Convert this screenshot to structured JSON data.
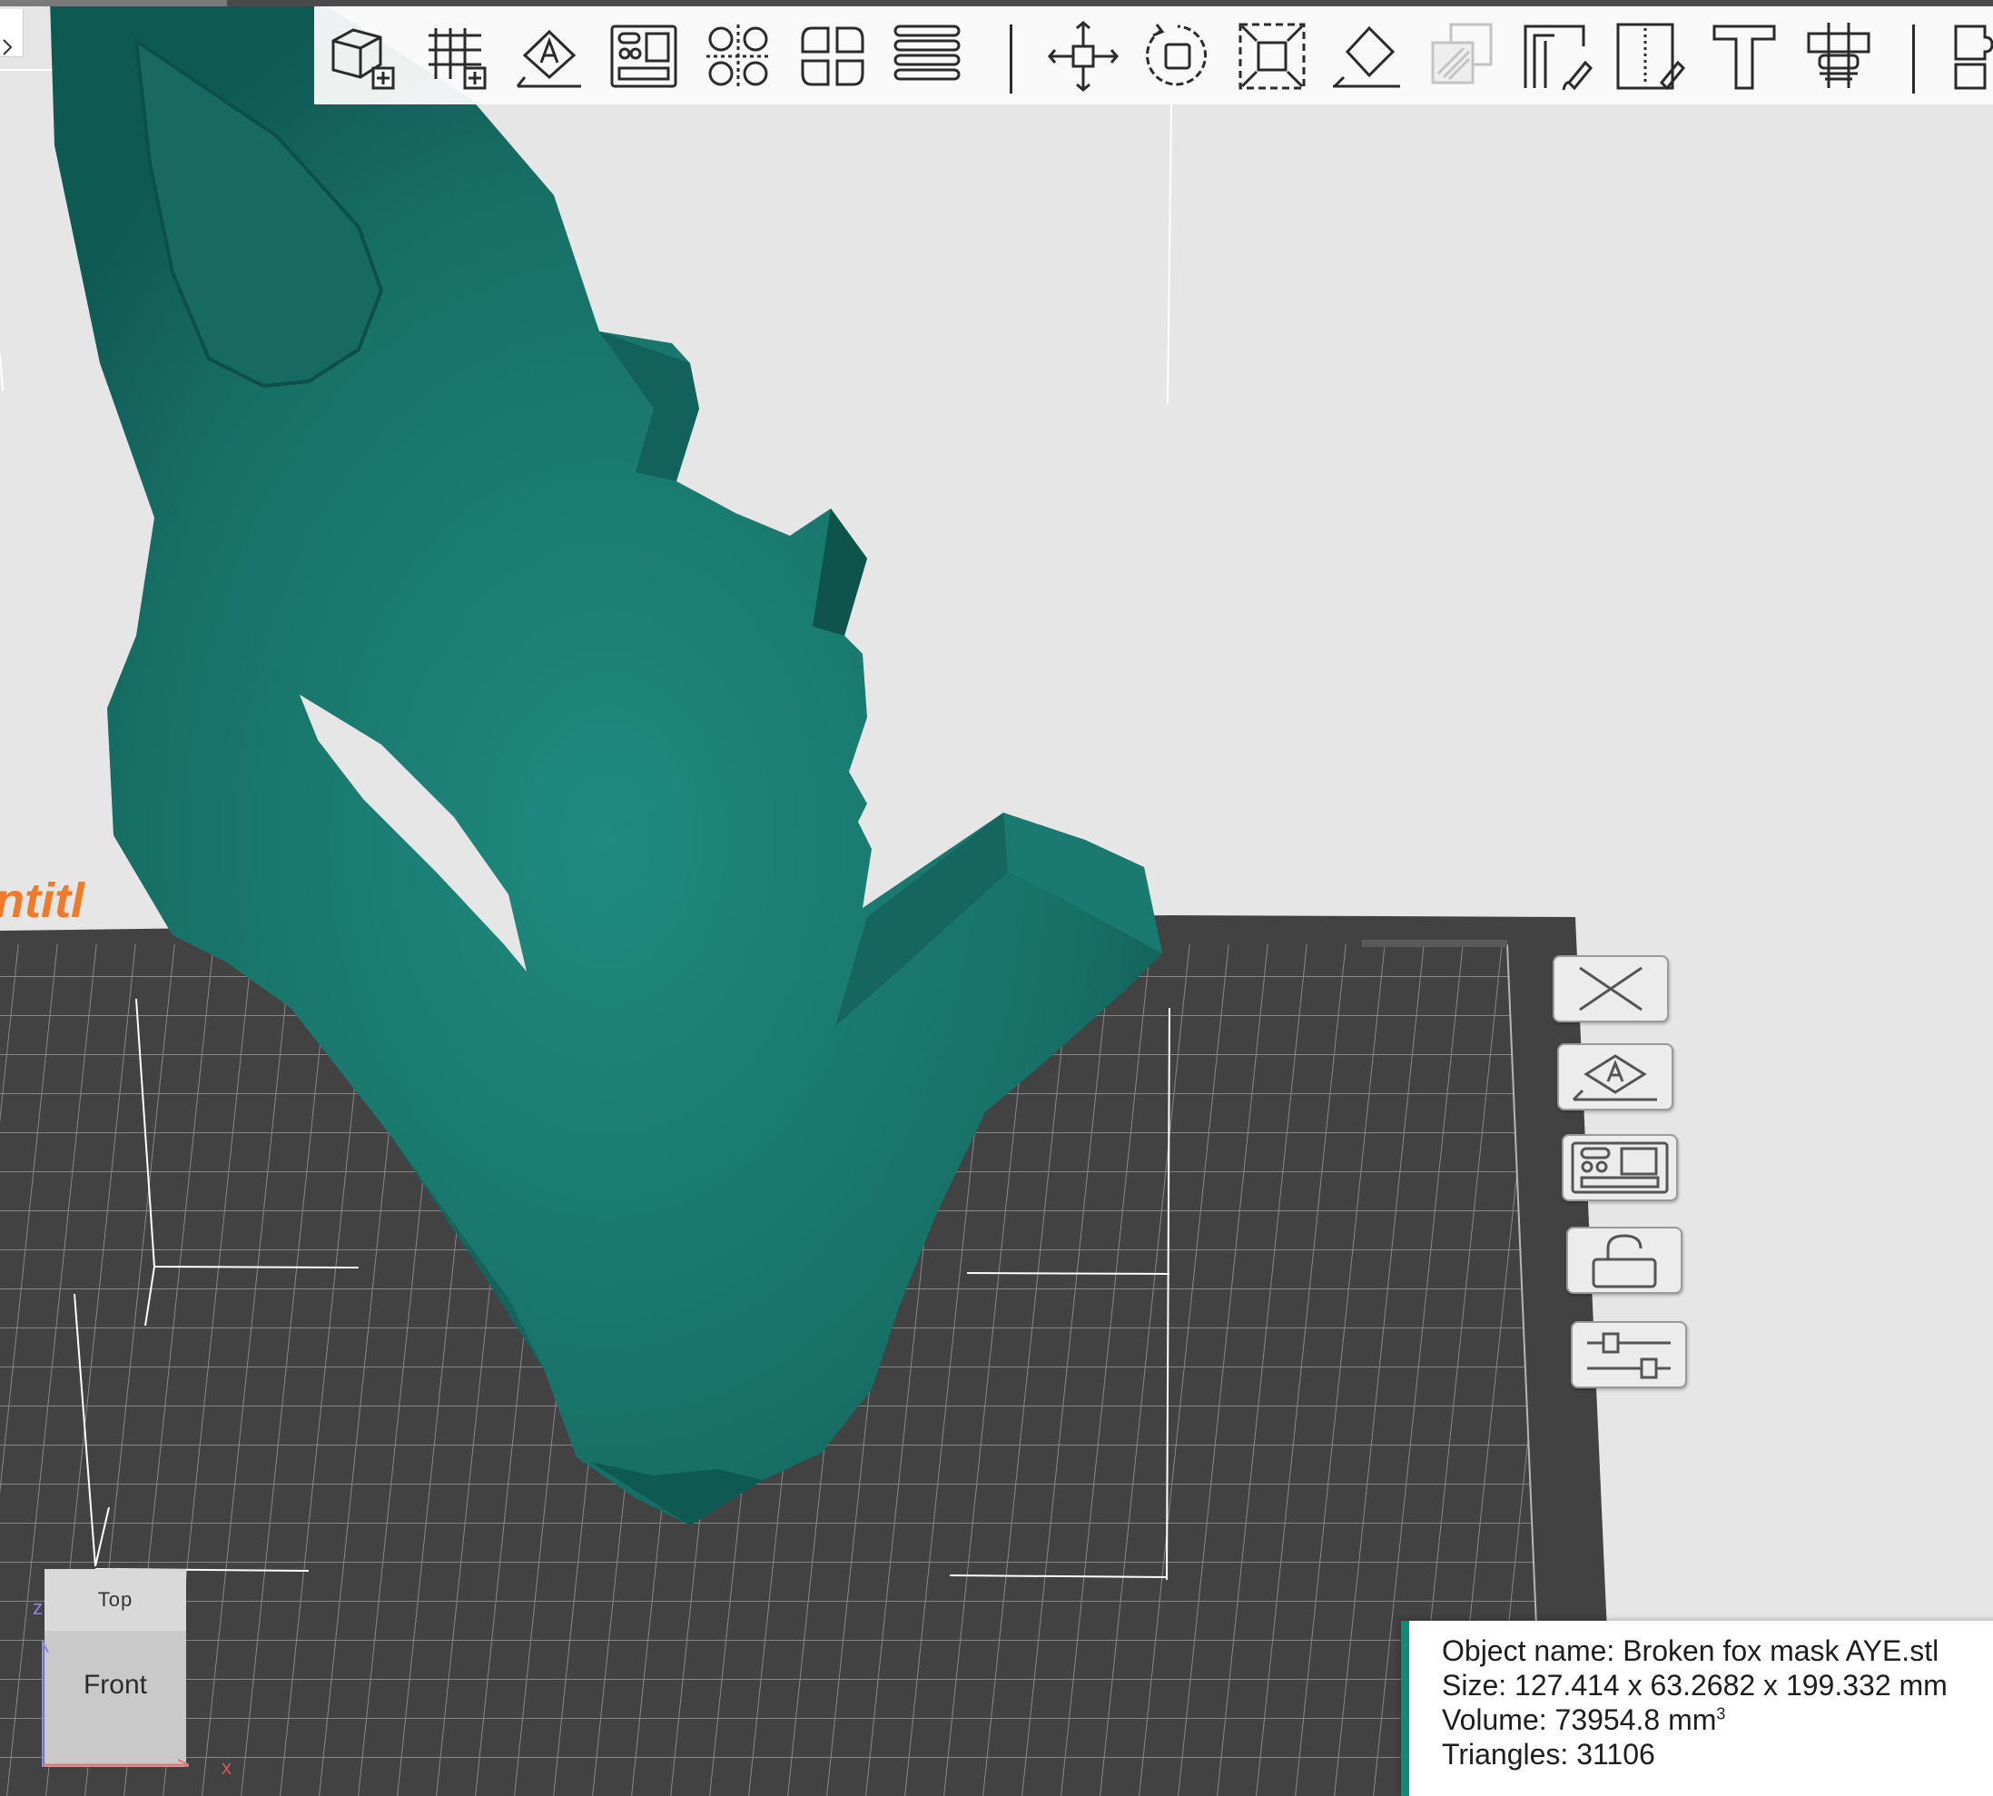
{
  "toolbar": {
    "buttons": [
      {
        "name": "add-object-icon",
        "label": "Add"
      },
      {
        "name": "add-plate-icon",
        "label": "Add plate"
      },
      {
        "name": "auto-orient-icon",
        "label": "Auto orient"
      },
      {
        "name": "arrange-icon",
        "label": "Arrange all objects"
      },
      {
        "name": "split-objects-icon",
        "label": "Split to objects"
      },
      {
        "name": "split-parts-icon",
        "label": "Split to parts"
      },
      {
        "name": "layers-icon",
        "label": "Variable layer height"
      },
      {
        "name": "move-icon",
        "label": "Move"
      },
      {
        "name": "rotate-icon",
        "label": "Rotate"
      },
      {
        "name": "scale-icon",
        "label": "Scale"
      },
      {
        "name": "lay-on-face-icon",
        "label": "Lay on face"
      },
      {
        "name": "cut-icon",
        "label": "Cut"
      },
      {
        "name": "support-paint-icon",
        "label": "Support painting"
      },
      {
        "name": "seam-paint-icon",
        "label": "Seam painting"
      },
      {
        "name": "text-icon",
        "label": "Text shape"
      },
      {
        "name": "measure-icon",
        "label": "Measure"
      },
      {
        "name": "assembly-icon",
        "label": "Assembly"
      }
    ]
  },
  "side_panel": {
    "buttons": [
      {
        "name": "close-icon",
        "label": "Close"
      },
      {
        "name": "auto-orient-icon",
        "label": "Auto orient"
      },
      {
        "name": "arrange-icon",
        "label": "Arrange"
      },
      {
        "name": "lock-icon",
        "label": "Lock"
      },
      {
        "name": "settings-sliders-icon",
        "label": "Settings"
      }
    ]
  },
  "plate": {
    "label_fragment": "ntitl"
  },
  "nav_cube": {
    "top_label": "Top",
    "front_label": "Front",
    "axis_x": "x",
    "axis_z": "z"
  },
  "info": {
    "object_name_line": "Object name: Broken fox mask AYE.stl",
    "size_line": "Size: 127.414 x 63.2682 x 199.332 mm",
    "volume_line": "Volume: 73954.8 mm",
    "volume_unit_sup": "3",
    "triangles_line": "Triangles: 31106"
  },
  "colors": {
    "model": "#1a7a72",
    "model_shadow": "#0f5a54",
    "plate": "#424242",
    "background": "#e6e6e6",
    "accent": "#0f8a76",
    "plate_label": "#f07a2a"
  }
}
